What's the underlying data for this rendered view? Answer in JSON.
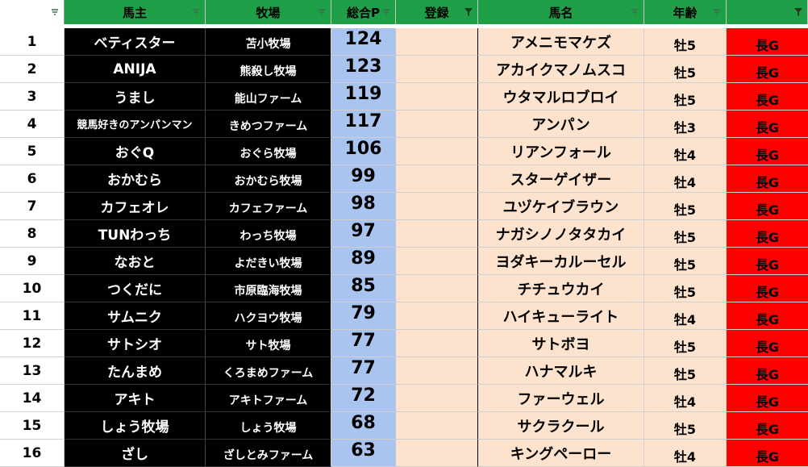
{
  "headers": [
    {
      "label": "",
      "filter": "filter-dropdown"
    },
    {
      "label": "馬主",
      "filter": "filter-dropdown"
    },
    {
      "label": "牧場",
      "filter": "filter-dropdown"
    },
    {
      "label": "総合P",
      "filter": "filter-dropdown"
    },
    {
      "label": "登録",
      "filter": "filter-active"
    },
    {
      "label": "馬名",
      "filter": "filter-dropdown"
    },
    {
      "label": "年齢",
      "filter": "filter-dropdown"
    },
    {
      "label": "",
      "filter": "filter-active"
    }
  ],
  "colors": {
    "header": "#1f9f47",
    "owner_bg": "#000000",
    "points_bg": "#a9c4ee",
    "horse_bg": "#fde3cd",
    "distance_bg": "#ff0000"
  },
  "rows": [
    {
      "num": "1",
      "owner": "ベティスター",
      "farm": "苫小牧場",
      "points": "124",
      "reg": "",
      "horse": "アメニモマケズ",
      "age": "牡5",
      "dist": "長G"
    },
    {
      "num": "2",
      "owner": "ANIJA",
      "farm": "熊殺し牧場",
      "points": "123",
      "reg": "",
      "horse": "アカイクマノムスコ",
      "age": "牡5",
      "dist": "長G"
    },
    {
      "num": "3",
      "owner": "うまし",
      "farm": "能山ファーム",
      "points": "119",
      "reg": "",
      "horse": "ウタマルロブロイ",
      "age": "牡5",
      "dist": "長G"
    },
    {
      "num": "4",
      "owner": "競馬好きのアンパンマン",
      "farm": "きめつファーム",
      "points": "117",
      "reg": "",
      "horse": "アンパン",
      "age": "牡3",
      "dist": "長G"
    },
    {
      "num": "5",
      "owner": "おぐQ",
      "farm": "おぐら牧場",
      "points": "106",
      "reg": "",
      "horse": "リアンフォール",
      "age": "牡4",
      "dist": "長G"
    },
    {
      "num": "6",
      "owner": "おかむら",
      "farm": "おかむら牧場",
      "points": "99",
      "reg": "",
      "horse": "スターゲイザー",
      "age": "牡4",
      "dist": "長G"
    },
    {
      "num": "7",
      "owner": "カフェオレ",
      "farm": "カフェファーム",
      "points": "98",
      "reg": "",
      "horse": "ユヅケイブラウン",
      "age": "牡5",
      "dist": "長G"
    },
    {
      "num": "8",
      "owner": "TUNわっち",
      "farm": "わっち牧場",
      "points": "97",
      "reg": "",
      "horse": "ナガシノノタタカイ",
      "age": "牡5",
      "dist": "長G"
    },
    {
      "num": "9",
      "owner": "なおと",
      "farm": "よだきい牧場",
      "points": "89",
      "reg": "",
      "horse": "ヨダキーカルーセル",
      "age": "牡5",
      "dist": "長G"
    },
    {
      "num": "10",
      "owner": "つくだに",
      "farm": "市原臨海牧場",
      "points": "85",
      "reg": "",
      "horse": "チチュウカイ",
      "age": "牡5",
      "dist": "長G"
    },
    {
      "num": "11",
      "owner": "サムニク",
      "farm": "ハクヨウ牧場",
      "points": "79",
      "reg": "",
      "horse": "ハイキューライト",
      "age": "牡4",
      "dist": "長G"
    },
    {
      "num": "12",
      "owner": "サトシオ",
      "farm": "サト牧場",
      "points": "77",
      "reg": "",
      "horse": "サトボヨ",
      "age": "牡5",
      "dist": "長G"
    },
    {
      "num": "13",
      "owner": "たんまめ",
      "farm": "くろまめファーム",
      "points": "77",
      "reg": "",
      "horse": "ハナマルキ",
      "age": "牡5",
      "dist": "長G"
    },
    {
      "num": "14",
      "owner": "アキト",
      "farm": "アキトファーム",
      "points": "72",
      "reg": "",
      "horse": "ファーウェル",
      "age": "牡4",
      "dist": "長G"
    },
    {
      "num": "15",
      "owner": "しょう牧場",
      "farm": "しょう牧場",
      "points": "68",
      "reg": "",
      "horse": "サクラクール",
      "age": "牡5",
      "dist": "長G"
    },
    {
      "num": "16",
      "owner": "ざし",
      "farm": "ざしとみファーム",
      "points": "63",
      "reg": "",
      "horse": "キングペーロー",
      "age": "牡4",
      "dist": "長G"
    }
  ]
}
